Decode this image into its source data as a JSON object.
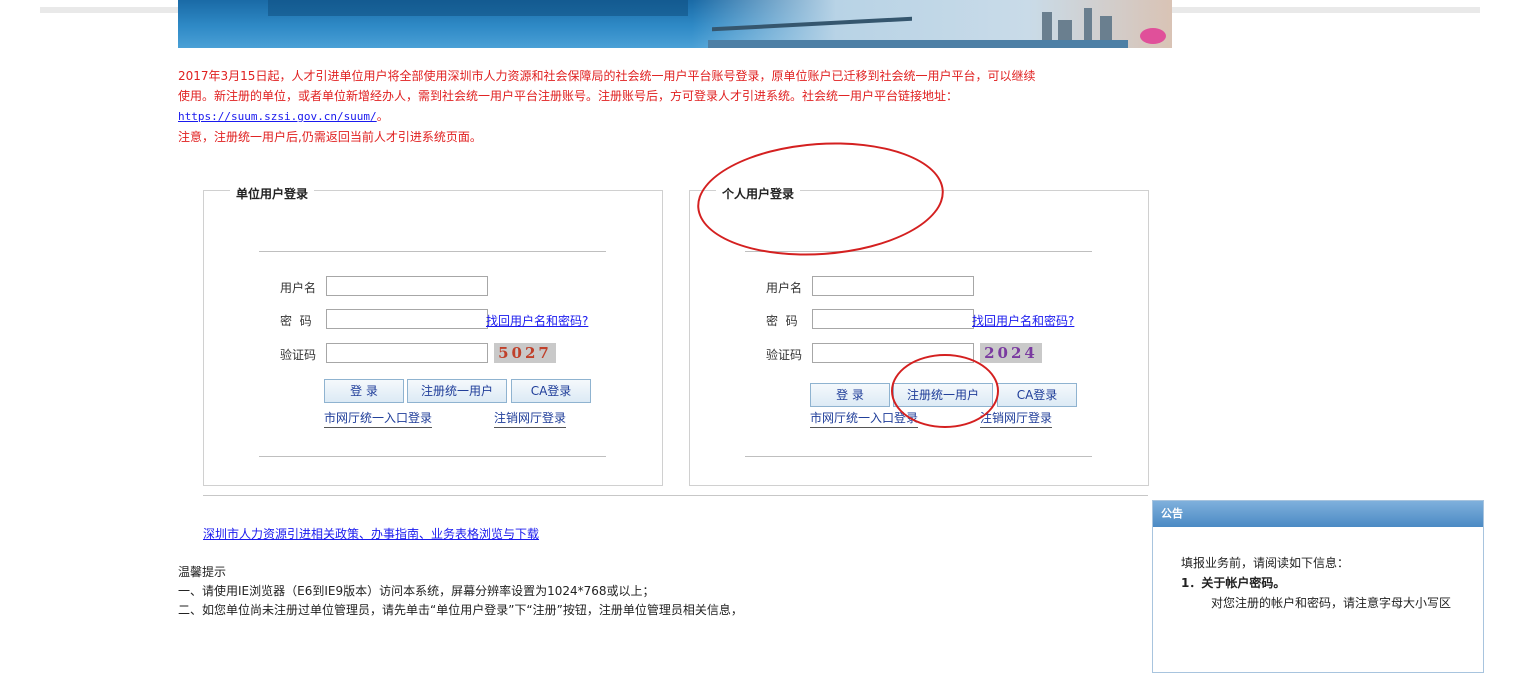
{
  "notice": {
    "line1": "2017年3月15日起，人才引进单位用户将全部使用深圳市人力资源和社会保障局的社会统一用户平台账号登录，原单位账户已迁移到社会统一用户平台，可以继续",
    "line2": "使用。新注册的单位，或者单位新增经办人，需到社会统一用户平台注册账号。注册账号后，方可登录人才引进系统。社会统一用户平台链接地址：",
    "link": "https://suum.szsi.gov.cn/suum/",
    "link_suffix": "。",
    "line4": "注意，注册统一用户后,仍需返回当前人才引进系统页面。"
  },
  "unit_login": {
    "title": "单位用户登录",
    "username_label": "用户名",
    "password_label": "密  码",
    "forgot_link": "找回用户名和密码?",
    "captcha_label": "验证码",
    "captcha_code": "5027",
    "login_button": "登 录",
    "register_button": "注册统一用户",
    "ca_button": "CA登录",
    "portal_link": "市网厅统一入口登录",
    "cancel_link": "注销网厅登录"
  },
  "personal_login": {
    "title": "个人用户登录",
    "username_label": "用户名",
    "password_label": "密  码",
    "forgot_link": "找回用户名和密码?",
    "captcha_label": "验证码",
    "captcha_code": "2024",
    "login_button": "登 录",
    "register_button": "注册统一用户",
    "ca_button": "CA登录",
    "portal_link": "市网厅统一入口登录",
    "cancel_link": "注销网厅登录"
  },
  "policy_link": "深圳市人力资源引进相关政策、办事指南、业务表格浏览与下载",
  "tips": {
    "title": "温馨提示",
    "item1": "一、请使用IE浏览器（E6到IE9版本）访问本系统，屏幕分辨率设置为1024*768或以上；",
    "item2": "二、如您单位尚未注册过单位管理员，请先单击“单位用户登录”下“注册”按钮，注册单位管理员相关信息，"
  },
  "announcement": {
    "title": "公告",
    "line1": "填报业务前，请阅读如下信息：",
    "line2": "1．关于帐户密码。",
    "line3": "对您注册的帐户和密码，请注意字母大小写区"
  },
  "colors": {
    "notice_red": "#e02020",
    "link_blue": "#1a1aee",
    "annotation_red": "#d42020",
    "announcement_header": "#4b8ac4"
  }
}
